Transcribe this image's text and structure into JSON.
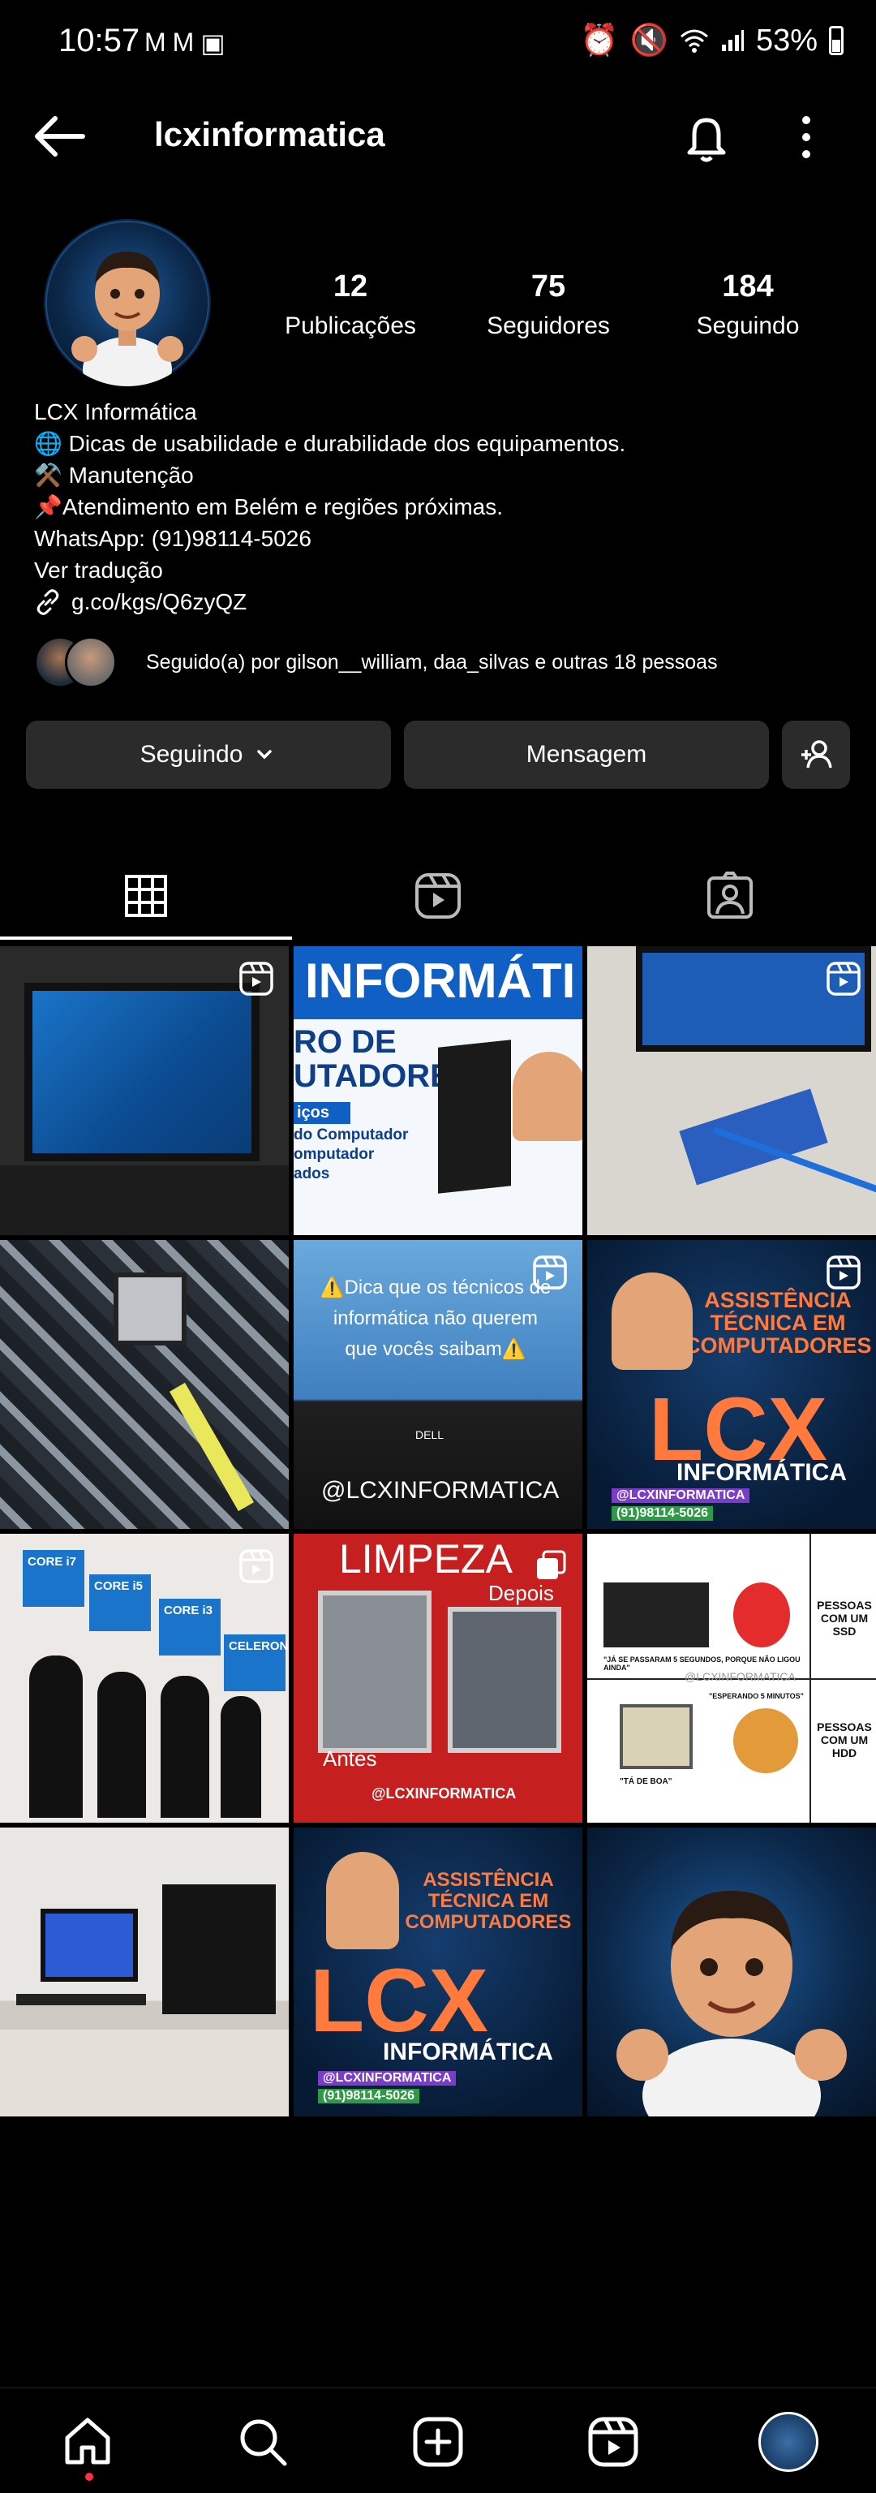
{
  "status_bar": {
    "time": "10:57",
    "left_icons": [
      "gmail-icon",
      "gmail-icon",
      "gallery-icon"
    ],
    "right_icons": [
      "alarm-icon",
      "mute-icon",
      "wifi-icon",
      "signal-icon"
    ],
    "battery": "53%"
  },
  "header": {
    "username": "lcxinformatica"
  },
  "stats": [
    {
      "value": "12",
      "label": "Publicações"
    },
    {
      "value": "75",
      "label": "Seguidores"
    },
    {
      "value": "184",
      "label": "Seguindo"
    }
  ],
  "bio": {
    "name": "LCX Informática",
    "line1": "🌐 Dicas de usabilidade e durabilidade dos equipamentos.",
    "line2": "⚒️ Manutenção",
    "line3": "📌Atendimento em Belém e regiões próximas.",
    "whatsapp": "WhatsApp: (91)98114-5026",
    "translate": "Ver tradução",
    "link": "g.co/kgs/Q6zyQZ"
  },
  "followed_by": "Seguido(a) por gilson__william, daa_silvas e outras 18 pessoas",
  "buttons": {
    "following": "Seguindo",
    "message": "Mensagem"
  },
  "tabs": [
    "grid-icon",
    "reels-icon",
    "tagged-icon"
  ],
  "posts": [
    {
      "type": "reel",
      "caption": ""
    },
    {
      "type": "image",
      "caption": "INFORMÁTI",
      "sub1": "RO DE",
      "sub2": "UTADORES",
      "sub3": "iços",
      "sub4": "do Computador",
      "sub5": "omputador",
      "sub6": "ados"
    },
    {
      "type": "reel",
      "caption": ""
    },
    {
      "type": "image",
      "caption": ""
    },
    {
      "type": "reel",
      "caption": "⚠️Dica que os técnicos de informática não querem que vocês saibam⚠️",
      "handle": "@LCXINFORMATICA",
      "brand": "DELL"
    },
    {
      "type": "reel",
      "caption": "ASSISTÊNCIA TÉCNICA EM COMPUTADORES",
      "logo": "LCX",
      "sub": "INFORMÁTICA",
      "ig": "@LCXINFORMATICA",
      "phone": "(91)98114-5026"
    },
    {
      "type": "reel",
      "caption": "",
      "chips": [
        "CORE i7",
        "CORE i5",
        "CORE i3",
        "CELERON"
      ]
    },
    {
      "type": "carousel",
      "caption": "LIMPEZA",
      "after": "Depois",
      "before": "Antes",
      "handle": "@LCXINFORMATICA"
    },
    {
      "type": "image",
      "caption": "",
      "top_label": "PESSOAS COM UM SSD",
      "bottom_label": "PESSOAS COM UM HDD",
      "quote1": "\"JÁ SE PASSARAM 5 SEGUNDOS, PORQUE NÃO LIGOU AINDA\"",
      "quote2": "\"ESPERANDO 5 MINUTOS\"",
      "quote3": "\"TÁ DE BOA\"",
      "watermark": "@LCXINFORMATICA"
    },
    {
      "type": "image",
      "caption": ""
    },
    {
      "type": "image",
      "caption": "ASSISTÊNCIA TÉCNICA EM COMPUTADORES",
      "logo": "LCX",
      "sub": "INFORMÁTICA",
      "ig": "@LCXINFORMATICA",
      "phone": "(91)98114-5026"
    },
    {
      "type": "image",
      "caption": ""
    }
  ],
  "bottom_nav": [
    "home-icon",
    "search-icon",
    "create-icon",
    "reels-icon",
    "profile-avatar"
  ],
  "colors": {
    "background": "#000000",
    "button": "#2b2b2b",
    "notification_dot": "#ff3040"
  }
}
